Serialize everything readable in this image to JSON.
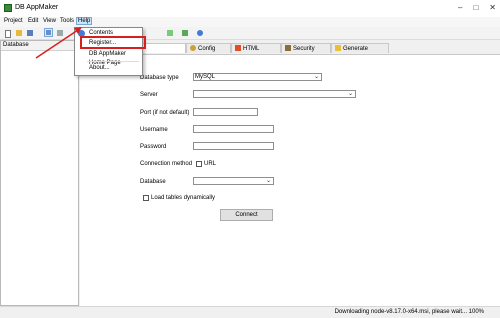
{
  "window": {
    "title": "DB AppMaker"
  },
  "menus": {
    "project": "Project",
    "edit": "Edit",
    "view": "View",
    "tools": "Tools",
    "help": "Help"
  },
  "help_menu": {
    "contents": "Contents",
    "register": "Register...",
    "home_page": "DB AppMaker Home Page",
    "about": "About..."
  },
  "left_pane": {
    "header": "Database"
  },
  "tabs": [
    "Config",
    "HTML",
    "Security",
    "Generate"
  ],
  "form": {
    "database_type_label": "Database type",
    "database_type_value": "MySQL",
    "server_label": "Server",
    "server_value": "",
    "port_label": "Port (if not default)",
    "port_value": "",
    "username_label": "Username",
    "username_value": "",
    "password_label": "Password",
    "password_value": "",
    "connection_method_label": "Connection method",
    "url_label": "URL",
    "database_label": "Database",
    "database_value": "",
    "load_tables_label": "Load tables dynamically",
    "connect_label": "Connect"
  },
  "status": {
    "text": "Downloading node-v8.17.0-x64.msi, please wait... 100%"
  },
  "colors": {
    "annotation_red": "#d62020",
    "menu_highlight": "#cce4f7"
  }
}
